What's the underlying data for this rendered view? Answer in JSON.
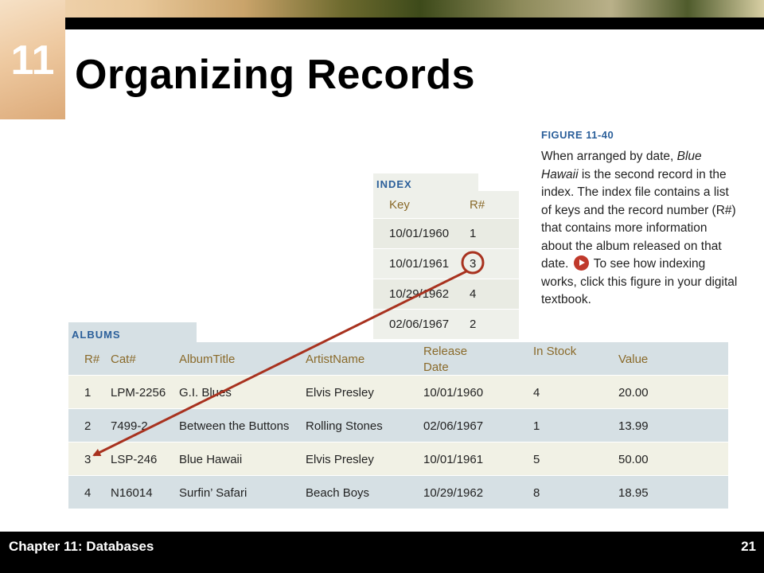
{
  "header": {
    "chapter_number": "11",
    "title": "Organizing Records"
  },
  "figure": {
    "number": "FIGURE 11-40",
    "caption_before_link": "When arranged by date, ",
    "caption_italic": "Blue Hawaii",
    "caption_middle": " is the second record in the index. The index file contains a list of keys and the record number (R#) that contains more information about the album released on that date. ",
    "caption_after_icon": " To see how indexing works, click this figure in your digital textbook."
  },
  "index_table": {
    "label": "INDEX",
    "headers": {
      "key": "Key",
      "r": "R#"
    },
    "rows": [
      {
        "key": "10/01/1960",
        "r": "1"
      },
      {
        "key": "10/01/1961",
        "r": "3"
      },
      {
        "key": "10/29/1962",
        "r": "4"
      },
      {
        "key": "02/06/1967",
        "r": "2"
      }
    ]
  },
  "albums_table": {
    "label": "ALBUMS",
    "headers": {
      "r": "R#",
      "cat": "Cat#",
      "title": "AlbumTitle",
      "artist": "ArtistName",
      "date": "Release Date",
      "stock": "In Stock",
      "value": "Value"
    },
    "rows": [
      {
        "r": "1",
        "cat": "LPM-2256",
        "title": "G.I. Blues",
        "artist": "Elvis Presley",
        "date": "10/01/1960",
        "stock": "4",
        "value": "20.00"
      },
      {
        "r": "2",
        "cat": "7499-2",
        "title": "Between the Buttons",
        "artist": "Rolling Stones",
        "date": "02/06/1967",
        "stock": "1",
        "value": "13.99"
      },
      {
        "r": "3",
        "cat": "LSP-246",
        "title": "Blue Hawaii",
        "artist": "Elvis Presley",
        "date": "10/01/1961",
        "stock": "5",
        "value": "50.00"
      },
      {
        "r": "4",
        "cat": "N16014",
        "title": "Surfin’ Safari",
        "artist": "Beach Boys",
        "date": "10/29/1962",
        "stock": "8",
        "value": "18.95"
      }
    ]
  },
  "annotation": {
    "arrow_color": "#a8321f",
    "highlight": "index row 2 R# circled, arrow to albums record 3"
  },
  "footer": {
    "chapter_label": "Chapter 11: Databases",
    "page_number": "21"
  }
}
